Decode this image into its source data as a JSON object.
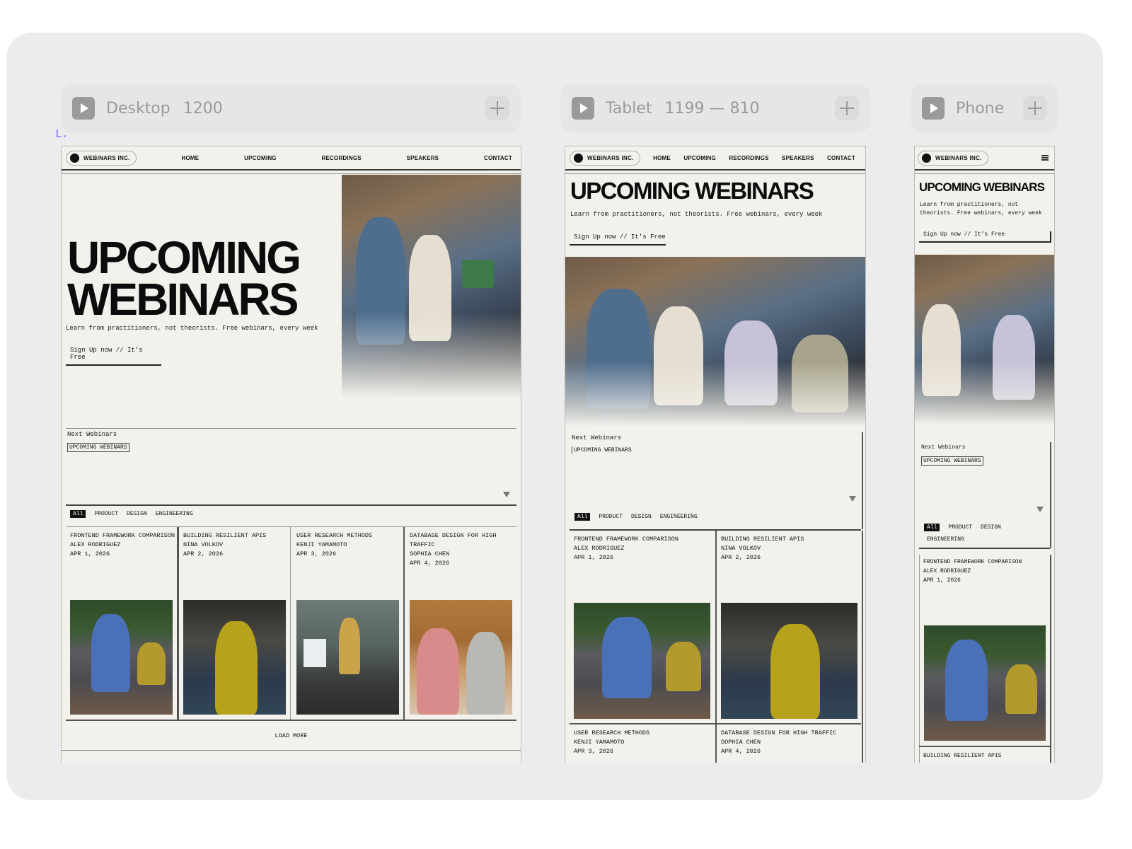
{
  "breakpoints": {
    "desktop": {
      "name": "Desktop",
      "size": "1200"
    },
    "tablet": {
      "name": "Tablet",
      "size": "1199 — 810"
    },
    "phone": {
      "name": "Phone",
      "size": ""
    }
  },
  "corner_mark": "L.",
  "site": {
    "logo": "WEBINARS INC.",
    "nav": [
      "HOME",
      "UPCOMING",
      "RECORDINGS",
      "SPEAKERS",
      "CONTACT"
    ],
    "hero_line1": "UPCOMING",
    "hero_line2": "WEBINARS",
    "hero_full": "UPCOMING WEBINARS",
    "subtitle": "Learn from practitioners, not theorists. Free webinars, every week",
    "phone_sub1": "Learn from practitioners, not",
    "phone_sub2": "theorists. Free webinars, every week",
    "signup": "Sign Up now // It's Free",
    "next_label": "Next Webinars",
    "select_value": "UPCOMING WEBINARS",
    "filters": [
      "All",
      "PRODUCT",
      "DESIGN",
      "ENGINEERING"
    ],
    "load_more": "LOAD MORE"
  },
  "cards": [
    {
      "title": "FRONTEND FRAMEWORK COMPARISON",
      "speaker": "ALEX RODRIGUEZ",
      "date": "APR 1, 2026"
    },
    {
      "title": "BUILDING RESILIENT APIS",
      "speaker": "NINA VOLKOV",
      "date": "APR 2, 2026"
    },
    {
      "title": "USER RESEARCH METHODS",
      "speaker": "KENJI YAMAMOTO",
      "date": "APR 3, 2026"
    },
    {
      "title": "DATABASE DESIGN FOR HIGH TRAFFIC",
      "title_l1": "DATABASE DESIGN FOR HIGH",
      "title_l2": "TRAFFIC",
      "speaker": "SOPHIA CHEN",
      "date": "APR 4, 2026"
    }
  ]
}
